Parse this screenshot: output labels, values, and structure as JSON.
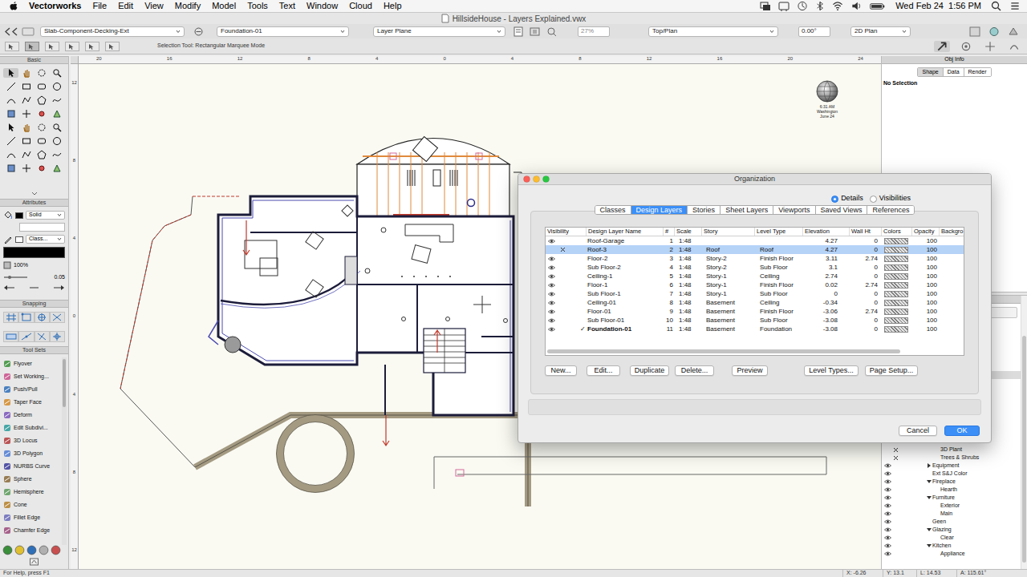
{
  "menubar": {
    "app": "Vectorworks",
    "menus": [
      "File",
      "Edit",
      "View",
      "Modify",
      "Model",
      "Tools",
      "Text",
      "Window",
      "Cloud",
      "Help"
    ],
    "clock": "Wed Feb 24  1:56 PM"
  },
  "window": {
    "title": "HillsideHouse - Layers Explained.vwx"
  },
  "view_bar": {
    "class": "Slab-Component-Decking-Ext",
    "layer": "Foundation-01",
    "plane": "Layer Plane",
    "zoom": "27%",
    "view": "Top/Plan",
    "rotation": "0.00°",
    "render": "2D Plan"
  },
  "mode_bar": {
    "hint": "Selection Tool: Rectangular Marquee Mode"
  },
  "tool_palette": {
    "basic_title": "Basic",
    "attributes_title": "Attributes",
    "fill_style": "Solid",
    "pen_style": "Class...",
    "opacity": "100%",
    "line_weight": "0.05",
    "snapping_title": "Snapping",
    "toolsets_title": "Tool Sets",
    "toolsets": [
      {
        "label": "Flyover"
      },
      {
        "label": "Set Working..."
      },
      {
        "label": "Push/Pull"
      },
      {
        "label": "Taper Face"
      },
      {
        "label": "Deform"
      },
      {
        "label": "Edit Subdivi..."
      },
      {
        "label": "3D Locus"
      },
      {
        "label": "3D Polygon"
      },
      {
        "label": "NURBS Curve"
      },
      {
        "label": "Sphere"
      },
      {
        "label": "Hemisphere"
      },
      {
        "label": "Cone"
      },
      {
        "label": "Fillet Edge"
      },
      {
        "label": "Chamfer Edge"
      }
    ]
  },
  "rulers": {
    "top": [
      "20",
      "16",
      "12",
      "8",
      "4",
      "0",
      "4",
      "8",
      "12",
      "16",
      "20",
      "24"
    ],
    "left": [
      "12",
      "8",
      "4",
      "0",
      "4",
      "8",
      "12"
    ]
  },
  "sun": {
    "time": "6:31 AM",
    "place": "Washington",
    "date": "June 24"
  },
  "obj_info": {
    "title": "Obj Info",
    "tabs": [
      {
        "label": "Shape",
        "selected": true
      },
      {
        "label": "Data",
        "selected": false
      },
      {
        "label": "Render",
        "selected": false
      }
    ],
    "selection": "No Selection"
  },
  "navigation": {
    "items": [
      {
        "label": "3D Plant",
        "visible": false,
        "depth": 2,
        "kind": "leaf"
      },
      {
        "label": "Trees & Shrubs",
        "visible": false,
        "depth": 2,
        "kind": "leaf"
      },
      {
        "label": "Equipment",
        "visible": true,
        "depth": 1,
        "kind": "group",
        "expanded": false
      },
      {
        "label": "Ext S&J Color",
        "visible": true,
        "depth": 1,
        "kind": "leaf"
      },
      {
        "label": "Fireplace",
        "visible": true,
        "depth": 1,
        "kind": "group",
        "expanded": true
      },
      {
        "label": "Hearth",
        "visible": true,
        "depth": 2,
        "kind": "leaf"
      },
      {
        "label": "Furniture",
        "visible": true,
        "depth": 1,
        "kind": "group",
        "expanded": true
      },
      {
        "label": "Exterior",
        "visible": true,
        "depth": 2,
        "kind": "leaf"
      },
      {
        "label": "Main",
        "visible": true,
        "depth": 2,
        "kind": "leaf"
      },
      {
        "label": "Geen",
        "visible": true,
        "depth": 1,
        "kind": "leaf"
      },
      {
        "label": "Glazing",
        "visible": true,
        "depth": 1,
        "kind": "group",
        "expanded": true
      },
      {
        "label": "Clear",
        "visible": true,
        "depth": 2,
        "kind": "leaf"
      },
      {
        "label": "Kitchen",
        "visible": true,
        "depth": 1,
        "kind": "group",
        "expanded": true
      },
      {
        "label": "Appliance",
        "visible": true,
        "depth": 2,
        "kind": "leaf"
      }
    ]
  },
  "dialog": {
    "title": "Organization",
    "modes": [
      {
        "label": "Details",
        "selected": true
      },
      {
        "label": "Visibilities",
        "selected": false
      }
    ],
    "tabs": [
      {
        "label": "Classes",
        "selected": false
      },
      {
        "label": "Design Layers",
        "selected": true
      },
      {
        "label": "Stories",
        "selected": false
      },
      {
        "label": "Sheet Layers",
        "selected": false
      },
      {
        "label": "Viewports",
        "selected": false
      },
      {
        "label": "Saved Views",
        "selected": false
      },
      {
        "label": "References",
        "selected": false
      }
    ],
    "table": {
      "columns": [
        "Visibility",
        "Design Layer Name",
        "#",
        "Scale",
        "Story",
        "Level Type",
        "Elevation",
        "Wall Ht",
        "Colors",
        "Opacity",
        "Backgro"
      ],
      "active_mark": "✓",
      "rows": [
        {
          "visible": true,
          "active": false,
          "selected": false,
          "name": "Roof-Garage",
          "number": "1",
          "scale": "1:48",
          "story": "",
          "level_type": "",
          "elevation": "4.27",
          "wall_ht": "0",
          "opacity": "100"
        },
        {
          "visible": false,
          "active": false,
          "selected": true,
          "name": "Roof-3",
          "number": "2",
          "scale": "1:48",
          "story": "Roof",
          "level_type": "Roof",
          "elevation": "4.27",
          "wall_ht": "0",
          "opacity": "100"
        },
        {
          "visible": true,
          "active": false,
          "selected": false,
          "name": "Floor-2",
          "number": "3",
          "scale": "1:48",
          "story": "Story-2",
          "level_type": "Finish Floor",
          "elevation": "3.11",
          "wall_ht": "2.74",
          "opacity": "100"
        },
        {
          "visible": true,
          "active": false,
          "selected": false,
          "name": "Sub Floor-2",
          "number": "4",
          "scale": "1:48",
          "story": "Story-2",
          "level_type": "Sub Floor",
          "elevation": "3.1",
          "wall_ht": "0",
          "opacity": "100"
        },
        {
          "visible": true,
          "active": false,
          "selected": false,
          "name": "Ceiling-1",
          "number": "5",
          "scale": "1:48",
          "story": "Story-1",
          "level_type": "Ceiling",
          "elevation": "2.74",
          "wall_ht": "0",
          "opacity": "100"
        },
        {
          "visible": true,
          "active": false,
          "selected": false,
          "name": "Floor-1",
          "number": "6",
          "scale": "1:48",
          "story": "Story-1",
          "level_type": "Finish Floor",
          "elevation": "0.02",
          "wall_ht": "2.74",
          "opacity": "100"
        },
        {
          "visible": true,
          "active": false,
          "selected": false,
          "name": "Sub Floor-1",
          "number": "7",
          "scale": "1:48",
          "story": "Story-1",
          "level_type": "Sub Floor",
          "elevation": "0",
          "wall_ht": "0",
          "opacity": "100"
        },
        {
          "visible": true,
          "active": false,
          "selected": false,
          "name": "Ceiling-01",
          "number": "8",
          "scale": "1:48",
          "story": "Basement",
          "level_type": "Ceiling",
          "elevation": "-0.34",
          "wall_ht": "0",
          "opacity": "100"
        },
        {
          "visible": true,
          "active": false,
          "selected": false,
          "name": "Floor-01",
          "number": "9",
          "scale": "1:48",
          "story": "Basement",
          "level_type": "Finish Floor",
          "elevation": "-3.06",
          "wall_ht": "2.74",
          "opacity": "100"
        },
        {
          "visible": true,
          "active": false,
          "selected": false,
          "name": "Sub Floor-01",
          "number": "10",
          "scale": "1:48",
          "story": "Basement",
          "level_type": "Sub Floor",
          "elevation": "-3.08",
          "wall_ht": "0",
          "opacity": "100"
        },
        {
          "visible": true,
          "active": true,
          "selected": false,
          "name": "Foundation-01",
          "number": "11",
          "scale": "1:48",
          "story": "Basement",
          "level_type": "Foundation",
          "elevation": "-3.08",
          "wall_ht": "0",
          "opacity": "100"
        }
      ]
    },
    "buttons": [
      "New...",
      "Edit...",
      "Duplicate",
      "Delete...",
      "Preview",
      "Level Types...",
      "Page Setup..."
    ],
    "cancel": "Cancel",
    "ok": "OK"
  },
  "status_bar": {
    "help": "For Help, press F1",
    "x": "X: -6.26",
    "y": "Y: 13.1",
    "l": "L: 14.53",
    "a": "A: 115.61°"
  }
}
